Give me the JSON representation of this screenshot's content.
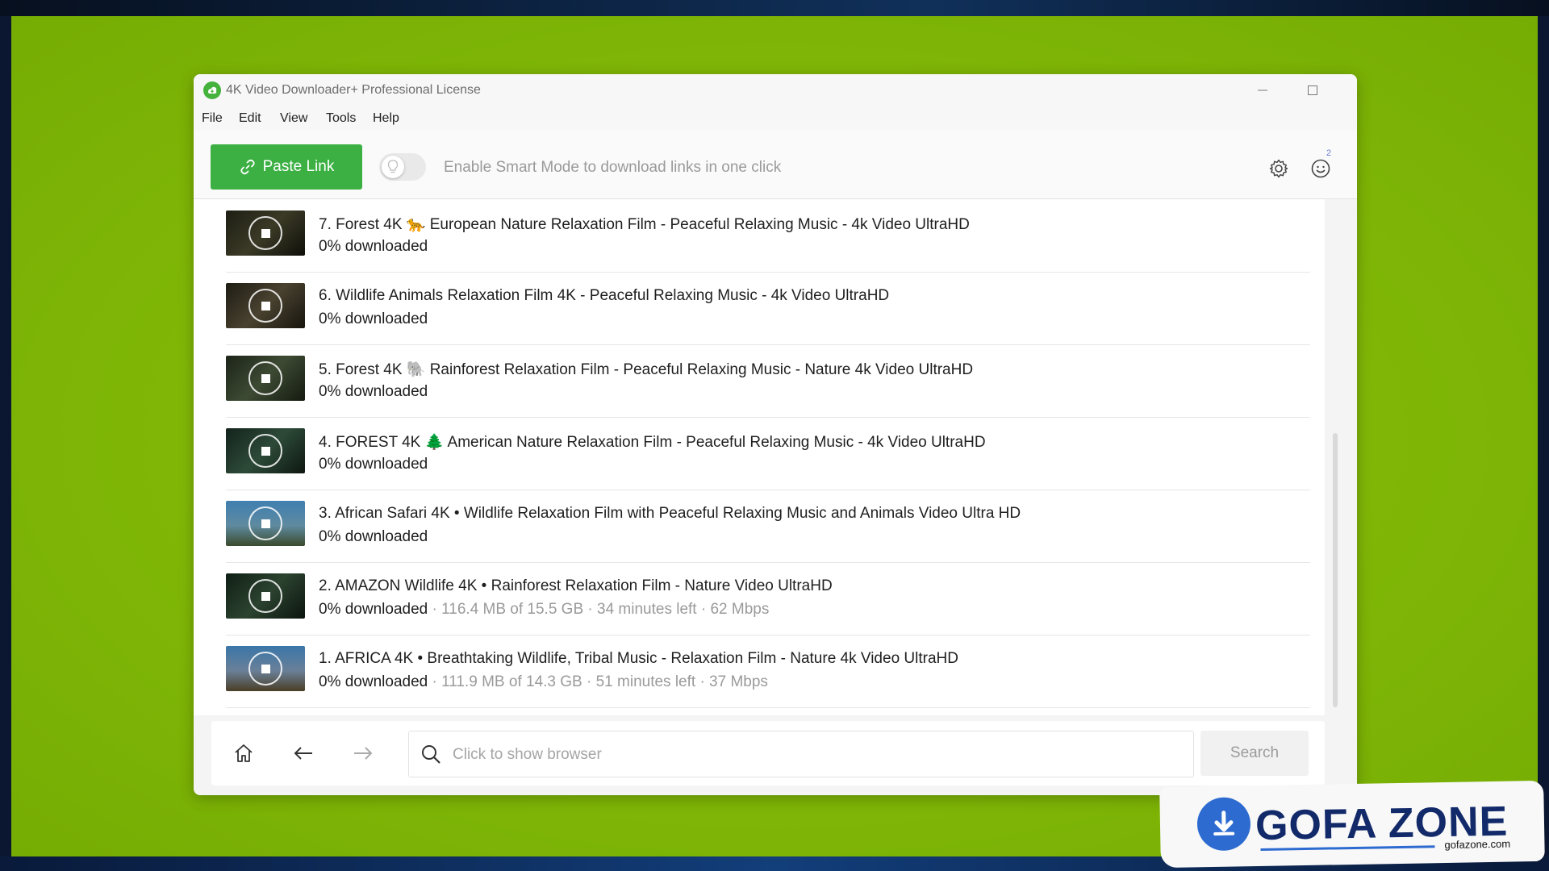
{
  "window": {
    "title": "4K Video Downloader+ Professional License"
  },
  "menu": [
    "File",
    "Edit",
    "View",
    "Tools",
    "Help"
  ],
  "toolbar": {
    "paste_label": "Paste Link",
    "smart_mode_text": "Enable Smart Mode to download links in one click",
    "account_badge": "2"
  },
  "downloads": [
    {
      "title": "7. Forest 4K 🐆 European Nature Relaxation Film - Peaceful Relaxing Music - 4k Video UltraHD",
      "status": "0% downloaded",
      "detail": ""
    },
    {
      "title": "6. Wildlife Animals Relaxation Film 4K - Peaceful Relaxing Music - 4k Video UltraHD",
      "status": "0% downloaded",
      "detail": ""
    },
    {
      "title": "5. Forest 4K 🐘 Rainforest Relaxation Film - Peaceful Relaxing Music - Nature 4k Video UltraHD",
      "status": "0% downloaded",
      "detail": ""
    },
    {
      "title": "4. FOREST 4K 🌲 American Nature Relaxation Film - Peaceful Relaxing Music - 4k Video UltraHD",
      "status": "0% downloaded",
      "detail": ""
    },
    {
      "title": "3. African Safari 4K • Wildlife Relaxation Film with Peaceful Relaxing Music and Animals Video Ultra HD",
      "status": "0% downloaded",
      "detail": ""
    },
    {
      "title": "2. AMAZON Wildlife 4K • Rainforest Relaxation Film - Nature Video UltraHD",
      "status": "0% downloaded",
      "detail": " · 116.4 MB of 15.5 GB · 34 minutes left · 62 Mbps"
    },
    {
      "title": "1. AFRICA 4K • Breathtaking Wildlife, Tribal Music - Relaxation Film - Nature 4k Video UltraHD",
      "status": "0% downloaded",
      "detail": " · 111.9 MB of 14.3 GB · 51 minutes left · 37 Mbps"
    }
  ],
  "browser": {
    "placeholder": "Click to show browser",
    "search_label": "Search"
  },
  "watermark": {
    "brand": "GOFA ZONE",
    "site": "gofazone.com"
  },
  "colors": {
    "accent": "#3cb043",
    "background": "#7fb606"
  }
}
